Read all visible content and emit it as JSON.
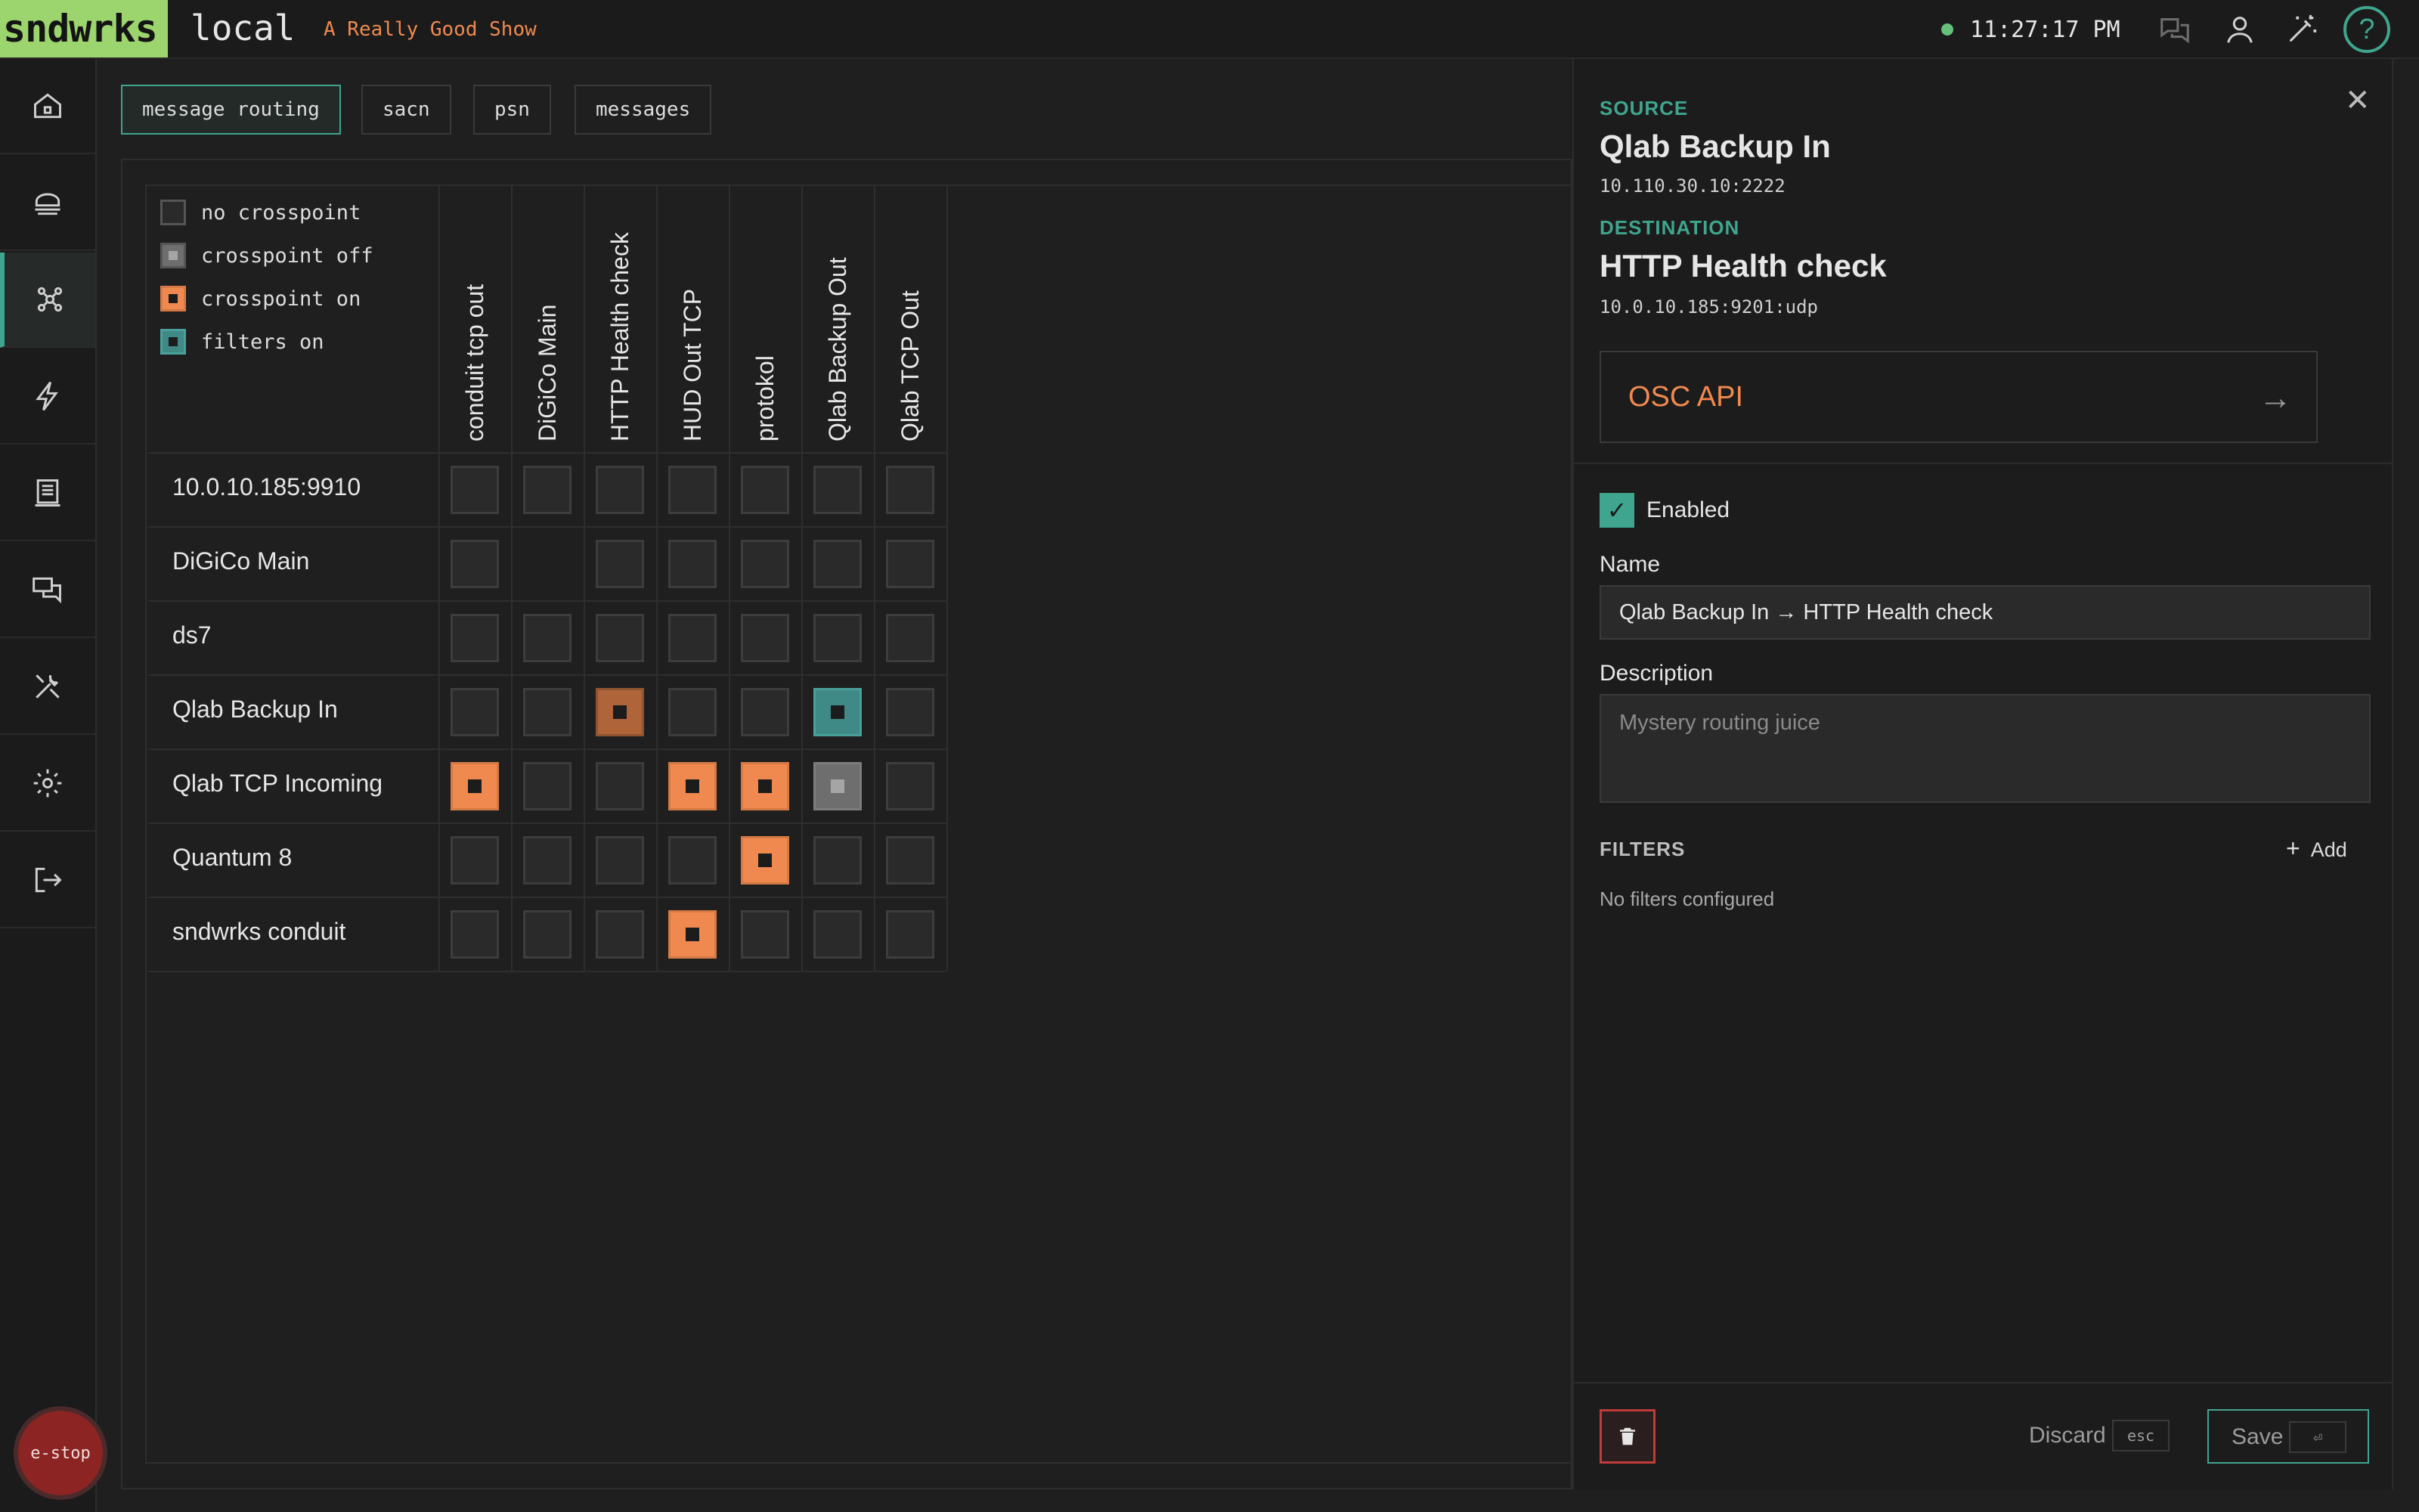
{
  "topbar": {
    "logo": "sndwrks",
    "environment": "local",
    "show_name": "A Really Good Show",
    "clock": "11:27:17 PM",
    "status": "connected",
    "icons": [
      "chat-icon",
      "user-icon",
      "magic-wand-icon",
      "help-icon"
    ],
    "help_glyph": "?"
  },
  "sidebar": {
    "items": [
      {
        "name": "home",
        "icon": "home-icon"
      },
      {
        "name": "network",
        "icon": "network-icon"
      },
      {
        "name": "routing",
        "icon": "routing-icon",
        "active": true
      },
      {
        "name": "triggers",
        "icon": "lightning-icon"
      },
      {
        "name": "display",
        "icon": "display-icon"
      },
      {
        "name": "messages",
        "icon": "messages-icon"
      },
      {
        "name": "tools",
        "icon": "tools-icon"
      },
      {
        "name": "settings",
        "icon": "gear-icon"
      },
      {
        "name": "logout",
        "icon": "logout-icon"
      }
    ],
    "estop_label": "e-stop"
  },
  "tabs": [
    {
      "label": "message routing",
      "active": true
    },
    {
      "label": "sacn",
      "active": false
    },
    {
      "label": "psn",
      "active": false
    },
    {
      "label": "messages",
      "active": false
    }
  ],
  "legend": [
    {
      "label": "no crosspoint",
      "state": "none"
    },
    {
      "label": "crosspoint off",
      "state": "off"
    },
    {
      "label": "crosspoint on",
      "state": "on"
    },
    {
      "label": "filters on",
      "state": "filters"
    }
  ],
  "matrix": {
    "columns": [
      "conduit tcp out",
      "DiGiCo Main",
      "HTTP Health check",
      "HUD Out TCP",
      "protokol",
      "Qlab Backup Out",
      "Qlab TCP Out"
    ],
    "rows": [
      {
        "label": "10.0.10.185:9910",
        "cells": [
          "none",
          "none",
          "none",
          "none",
          "none",
          "none",
          "none"
        ]
      },
      {
        "label": "DiGiCo Main",
        "cells": [
          "none",
          "blank",
          "none",
          "none",
          "none",
          "none",
          "none"
        ]
      },
      {
        "label": "ds7",
        "cells": [
          "none",
          "none",
          "none",
          "none",
          "none",
          "none",
          "none"
        ]
      },
      {
        "label": "Qlab Backup In",
        "cells": [
          "none",
          "none",
          "selected",
          "none",
          "none",
          "filters",
          "none"
        ]
      },
      {
        "label": "Qlab TCP Incoming",
        "cells": [
          "on",
          "none",
          "none",
          "on",
          "on",
          "off",
          "none"
        ]
      },
      {
        "label": "Quantum 8",
        "cells": [
          "none",
          "none",
          "none",
          "none",
          "on",
          "none",
          "none"
        ]
      },
      {
        "label": "sndwrks conduit",
        "cells": [
          "none",
          "none",
          "none",
          "on",
          "none",
          "none",
          "none"
        ]
      }
    ]
  },
  "panel": {
    "source_label": "SOURCE",
    "source_name": "Qlab Backup In",
    "source_address": "10.110.30.10:2222",
    "destination_label": "DESTINATION",
    "destination_name": "HTTP Health check",
    "destination_address": "10.0.10.185:9201:udp",
    "protocol": "OSC API",
    "enabled_label": "Enabled",
    "enabled": true,
    "name_label": "Name",
    "name_value": "Qlab Backup In → HTTP Health check",
    "description_label": "Description",
    "description_placeholder": "Mystery routing juice",
    "filters_title": "FILTERS",
    "filters_add": "Add",
    "no_filters": "No filters configured",
    "discard_label": "Discard",
    "discard_key": "esc",
    "save_label": "Save",
    "save_key": "⏎"
  },
  "colors": {
    "accent": "#3fa58e",
    "crosspoint_on": "#f0894f",
    "filters_on": "#3f8a86",
    "logo": "#9cd46e"
  }
}
